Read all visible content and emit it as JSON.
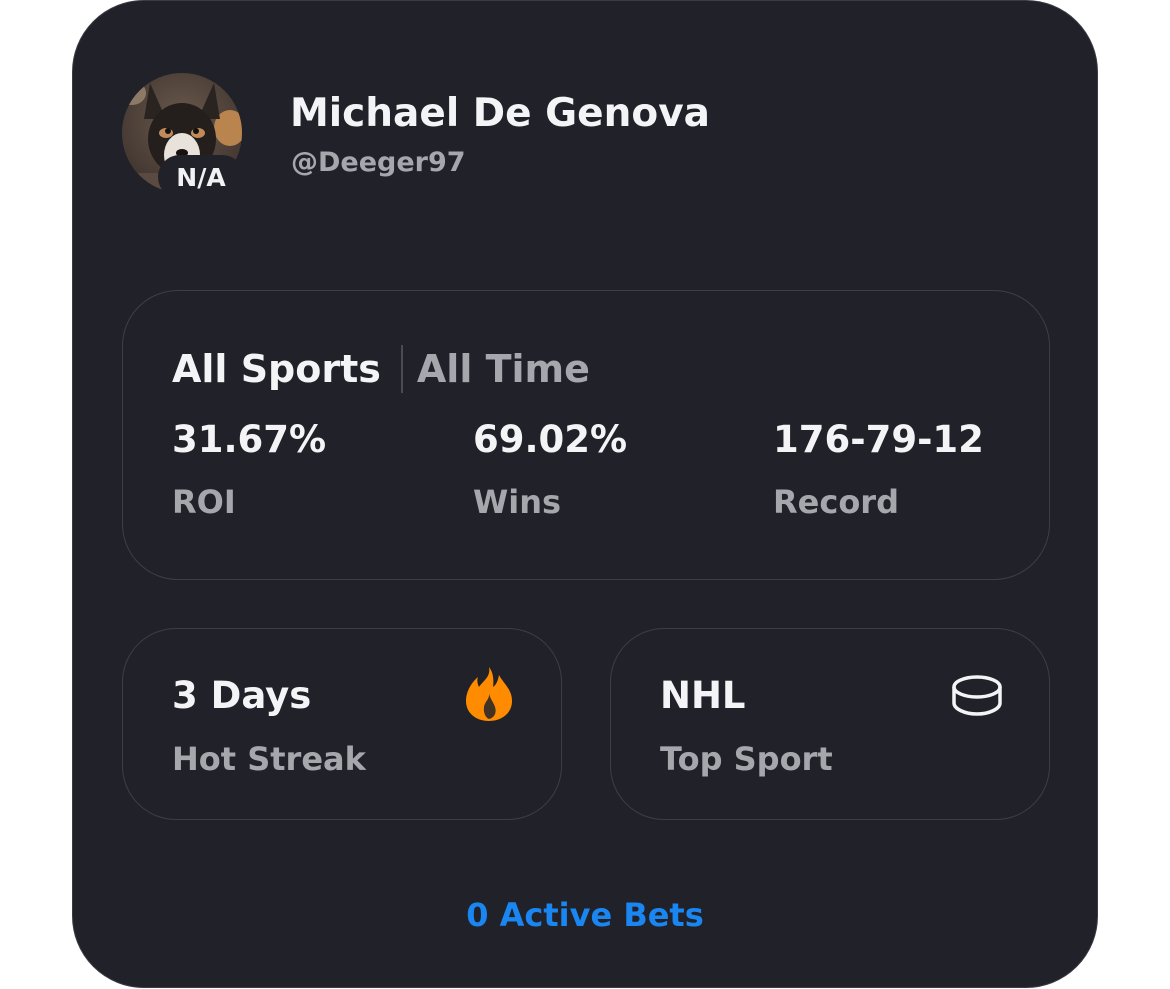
{
  "profile": {
    "name": "Michael De Genova",
    "handle": "@Deeger97",
    "avatar_badge": "N/A"
  },
  "filters": {
    "sport": "All Sports",
    "period": "All Time"
  },
  "stats": [
    {
      "value": "31.67%",
      "label": "ROI"
    },
    {
      "value": "69.02%",
      "label": "Wins"
    },
    {
      "value": "176-79-12",
      "label": "Record"
    }
  ],
  "streak": {
    "value": "3 Days",
    "label": "Hot Streak",
    "icon": "fire-icon"
  },
  "top_sport": {
    "value": "NHL",
    "label": "Top Sport",
    "icon": "hockey-puck-icon"
  },
  "footer": {
    "active_bets": "0 Active Bets"
  },
  "colors": {
    "background": "#212229",
    "border": "#3d3e47",
    "text_primary": "#f4f4f7",
    "text_secondary": "#a6a6ad",
    "accent": "#1a86f2",
    "fire": "#ff8c00"
  }
}
